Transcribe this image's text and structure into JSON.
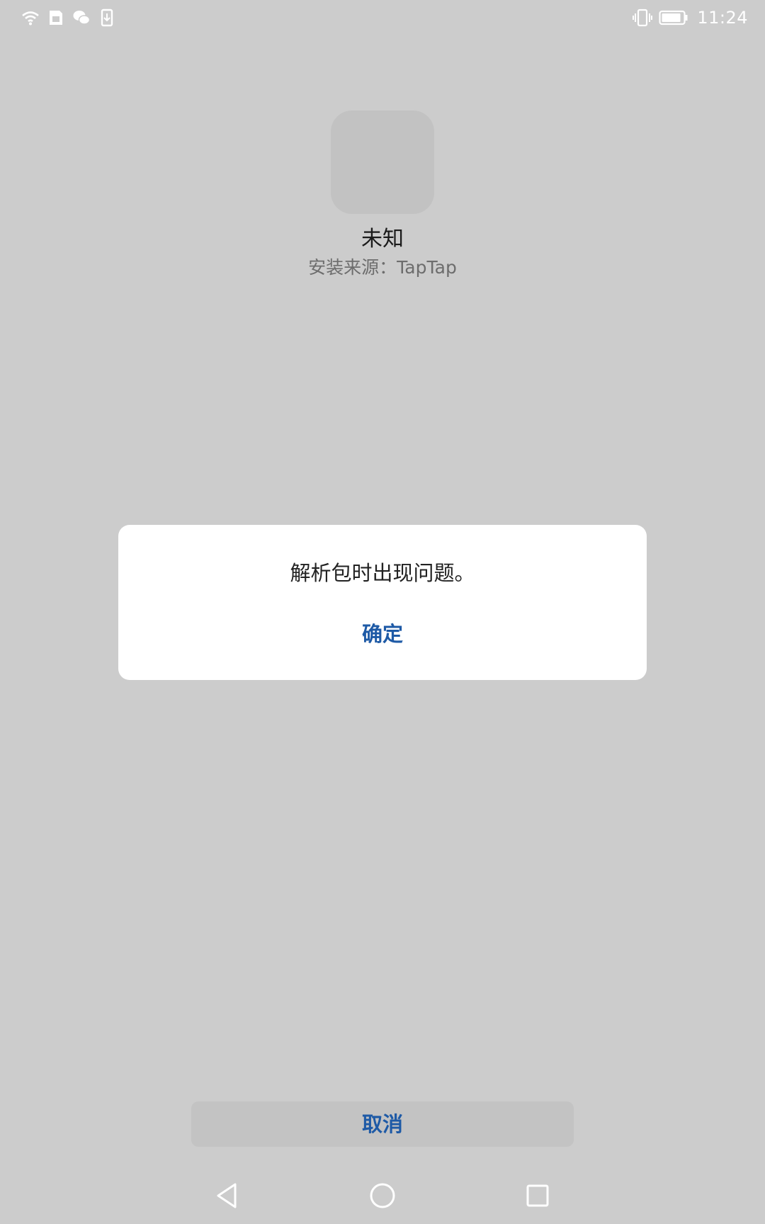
{
  "status_bar": {
    "time": "11:24",
    "left_icons": [
      "wifi-icon",
      "sim-icon",
      "wechat-icon",
      "download-icon"
    ],
    "right_icons": [
      "vibrate-icon",
      "battery-icon"
    ]
  },
  "app": {
    "name": "未知",
    "source": "安装来源：TapTap"
  },
  "dialog": {
    "message": "解析包时出现问题。",
    "ok_label": "确定"
  },
  "footer": {
    "cancel_label": "取消"
  },
  "navigation": {
    "buttons": [
      "back-icon",
      "home-icon",
      "recents-icon"
    ]
  },
  "colors": {
    "background": "#cccccc",
    "accent": "#1e5aa6",
    "dialog_bg": "#ffffff"
  }
}
